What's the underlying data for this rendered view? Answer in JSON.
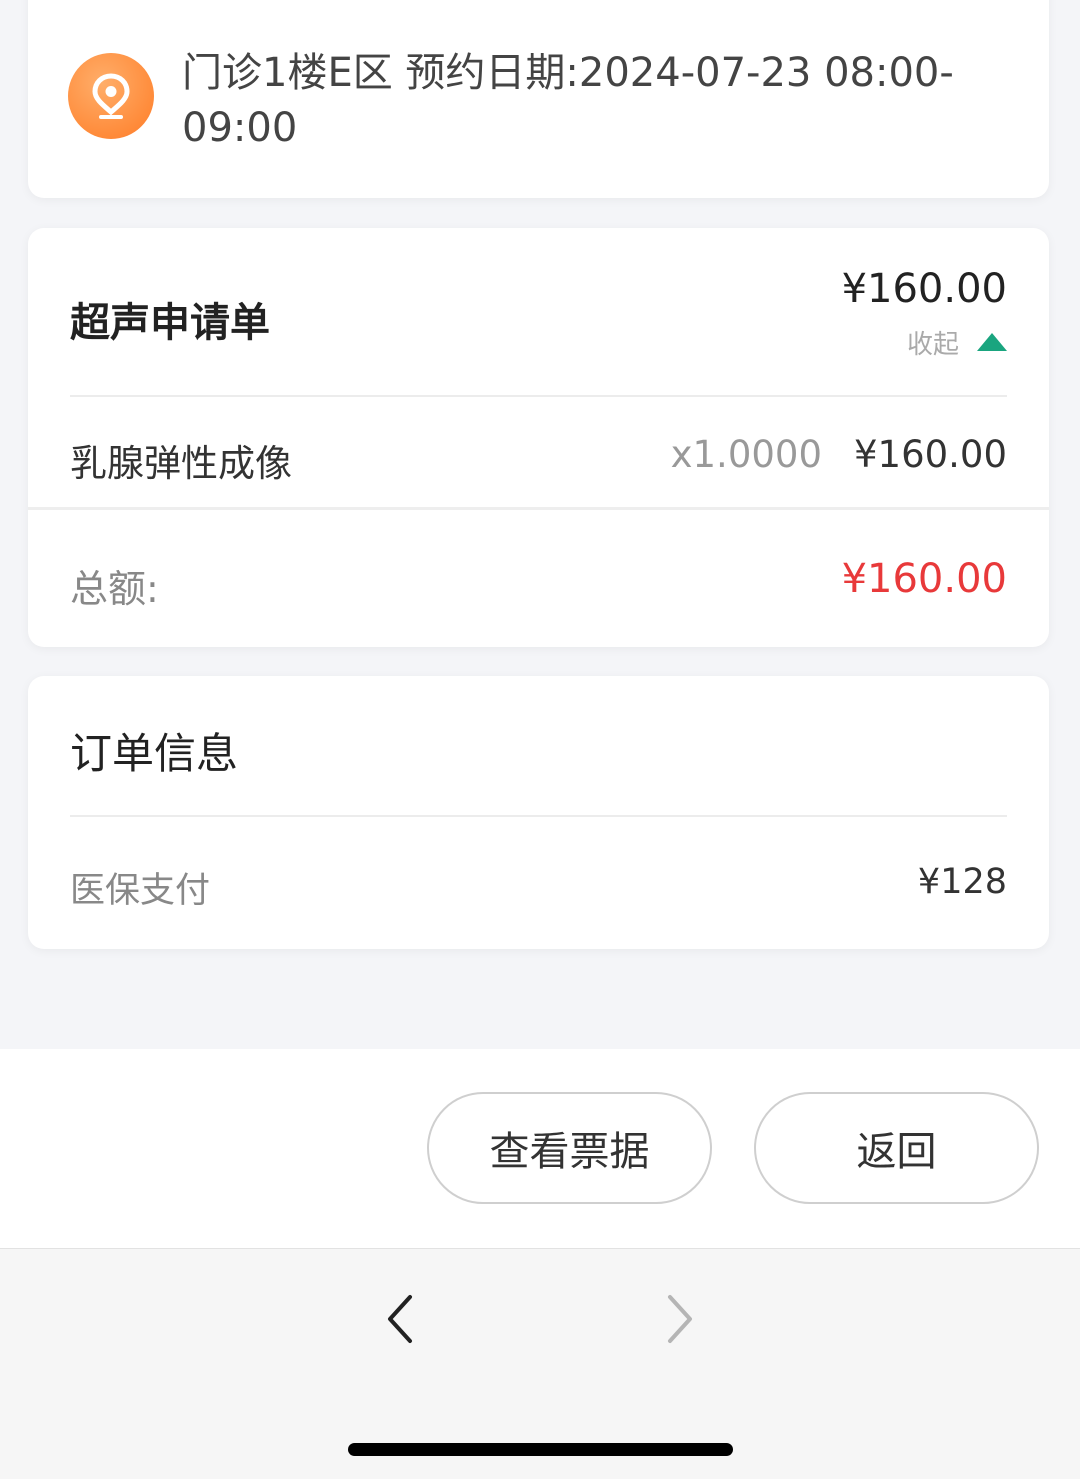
{
  "location": {
    "line1": "门诊1楼E区 预约日期:2024-07-23 08:00-",
    "line2": "09:00",
    "icon": "location-pin-icon"
  },
  "bill": {
    "title": "超声申请单",
    "total_top": "¥160.00",
    "collapse_label": "收起",
    "items": [
      {
        "name": "乳腺弹性成像",
        "qty": "x1.0000",
        "price": "¥160.00"
      }
    ],
    "total_label": "总额:",
    "total_value": "¥160.00"
  },
  "order": {
    "title": "订单信息",
    "rows": [
      {
        "label": "医保支付",
        "value": "¥128"
      }
    ]
  },
  "actions": {
    "view_receipt": "查看票据",
    "back": "返回"
  },
  "colors": {
    "accent_green": "#1aa57f",
    "total_red": "#e8393a",
    "icon_orange": "#ff8b3a"
  }
}
